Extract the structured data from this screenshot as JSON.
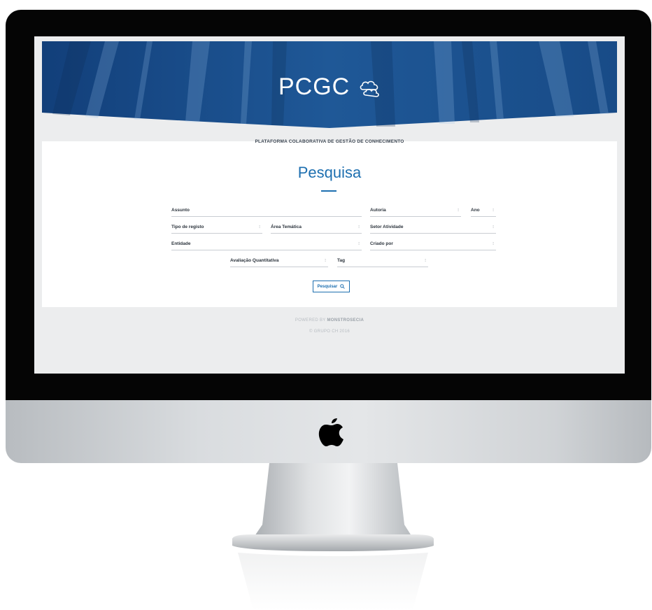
{
  "site": {
    "logo_text": "PCGC",
    "subtitle": "PLATAFORMA COLABORATIVA DE GESTÃO DE CONHECIMENTO"
  },
  "search": {
    "heading": "Pesquisa",
    "fields": {
      "assunto": "Assunto",
      "autoria": "Autoria",
      "ano": "Ano",
      "tipo_registo": "Tipo de registo",
      "area_tematica": "Área Temática",
      "setor_atividade": "Setor Atividade",
      "entidade": "Entidade",
      "criado_por": "Criado por",
      "avaliacao": "Avaliação Quantitativa",
      "tag": "Tag"
    },
    "button_label": "Pesquisar"
  },
  "footer": {
    "powered_prefix": "POWERED BY",
    "powered_brand": "MONSTROSECIA",
    "copyright": "© GRUPO CH 2016"
  },
  "colors": {
    "accent": "#1d6fb0",
    "hero_dark": "#123f7a",
    "hero_light": "#2a67a8"
  },
  "icons": [
    "cloud-icon",
    "search-icon",
    "apple-logo-icon",
    "chevron-down-icon"
  ]
}
